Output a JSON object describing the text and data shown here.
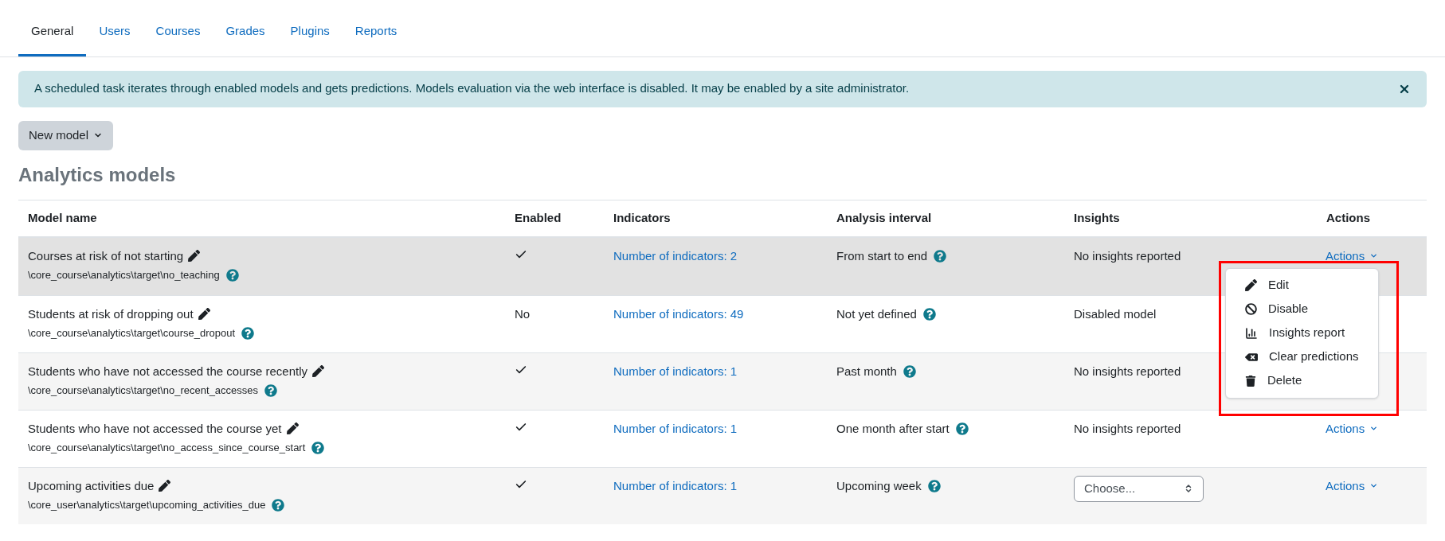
{
  "tabs": [
    {
      "label": "General",
      "selected": true
    },
    {
      "label": "Users",
      "selected": false
    },
    {
      "label": "Courses",
      "selected": false
    },
    {
      "label": "Grades",
      "selected": false
    },
    {
      "label": "Plugins",
      "selected": false
    },
    {
      "label": "Reports",
      "selected": false
    }
  ],
  "alert": {
    "text": "A scheduled task iterates through enabled models and gets predictions. Models evaluation via the web interface is disabled. It may be enabled by a site administrator."
  },
  "new_model_button": "New model",
  "heading": "Analytics models",
  "table": {
    "columns": [
      "Model name",
      "Enabled",
      "Indicators",
      "Analysis interval",
      "Insights",
      "Actions"
    ],
    "rows": [
      {
        "name": "Courses at risk of not starting",
        "target": "\\core_course\\analytics\\target\\no_teaching",
        "enabled": {
          "kind": "check"
        },
        "indicators": "Number of indicators: 2",
        "interval": "From start to end",
        "insights": {
          "kind": "text",
          "text": "No insights reported"
        },
        "actions": "Actions",
        "hovered": true,
        "menu_open": true
      },
      {
        "name": "Students at risk of dropping out",
        "target": "\\core_course\\analytics\\target\\course_dropout",
        "enabled": {
          "kind": "text",
          "text": "No"
        },
        "indicators": "Number of indicators: 49",
        "interval": "Not yet defined",
        "insights": {
          "kind": "text",
          "text": "Disabled model"
        },
        "hovered": false,
        "menu_open": false
      },
      {
        "name": "Students who have not accessed the course recently",
        "target": "\\core_course\\analytics\\target\\no_recent_accesses",
        "enabled": {
          "kind": "check"
        },
        "indicators": "Number of indicators: 1",
        "interval": "Past month",
        "insights": {
          "kind": "text",
          "text": "No insights reported"
        },
        "hovered": false,
        "menu_open": false
      },
      {
        "name": "Students who have not accessed the course yet",
        "target": "\\core_course\\analytics\\target\\no_access_since_course_start",
        "enabled": {
          "kind": "check"
        },
        "indicators": "Number of indicators: 1",
        "interval": "One month after start",
        "insights": {
          "kind": "text",
          "text": "No insights reported"
        },
        "actions": "Actions",
        "hovered": false,
        "menu_open": false
      },
      {
        "name": "Upcoming activities due",
        "target": "\\core_user\\analytics\\target\\upcoming_activities_due",
        "enabled": {
          "kind": "check"
        },
        "indicators": "Number of indicators: 1",
        "interval": "Upcoming week",
        "insights": {
          "kind": "select",
          "text": "Choose..."
        },
        "actions": "Actions",
        "hovered": false,
        "menu_open": false
      }
    ]
  },
  "actions_menu": {
    "highlighted": true,
    "items": [
      {
        "label": "Edit"
      },
      {
        "label": "Disable"
      },
      {
        "label": "Insights report"
      },
      {
        "label": "Clear predictions"
      },
      {
        "label": "Delete"
      }
    ]
  }
}
